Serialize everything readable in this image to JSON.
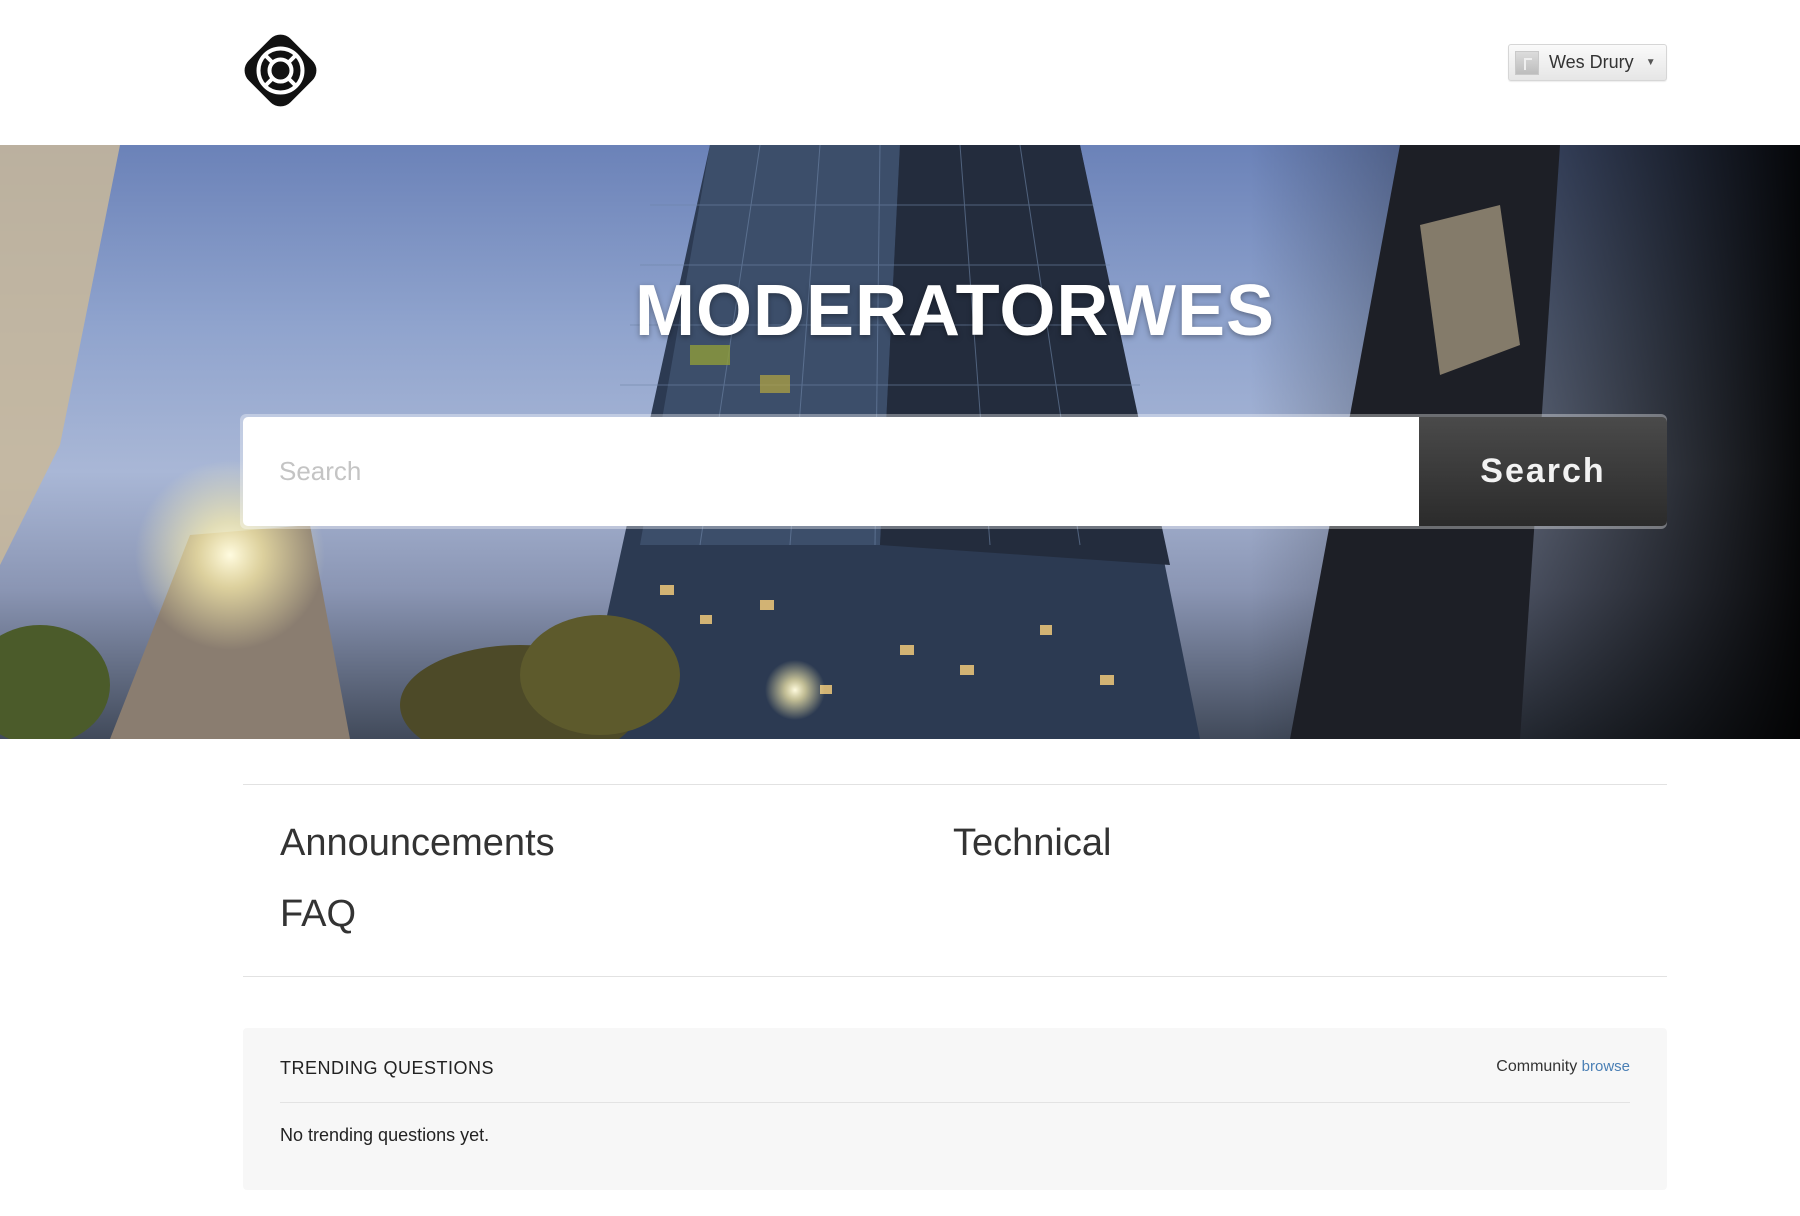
{
  "header": {
    "user_name": "Wes Drury",
    "caret": "▼"
  },
  "hero": {
    "title": "MODERATORWES",
    "search_placeholder": "Search",
    "search_button": "Search"
  },
  "categories": [
    {
      "label": "Announcements"
    },
    {
      "label": "Technical"
    },
    {
      "label": "FAQ"
    }
  ],
  "trending": {
    "title": "TRENDING QUESTIONS",
    "community_label": "Community",
    "browse_label": "browse",
    "empty_message": "No trending questions yet."
  },
  "colors": {
    "search_button": "#2f2f2f",
    "link": "#4a7fb5",
    "panel_bg": "#f7f7f7"
  }
}
